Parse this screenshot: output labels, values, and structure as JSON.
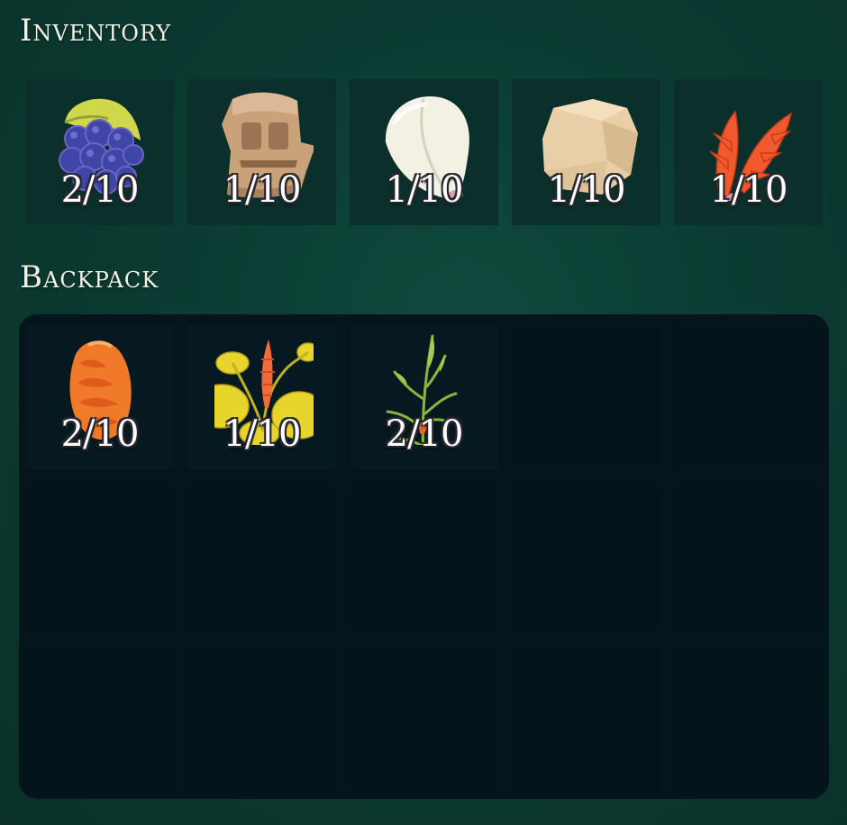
{
  "inventory": {
    "title": "Inventory",
    "slots": [
      {
        "icon": "purple-berry-cluster-icon",
        "count": "2/10"
      },
      {
        "icon": "carved-stone-idol-icon",
        "count": "1/10"
      },
      {
        "icon": "white-seed-pod-icon",
        "count": "1/10"
      },
      {
        "icon": "pale-stone-icon",
        "count": "1/10"
      },
      {
        "icon": "red-flower-spike-icon",
        "count": "1/10"
      }
    ]
  },
  "backpack": {
    "title": "Backpack",
    "slots": [
      {
        "icon": "orange-pinecone-fruit-icon",
        "count": "2/10"
      },
      {
        "icon": "yellow-leaf-plant-icon",
        "count": "1/10"
      },
      {
        "icon": "green-grass-stalk-icon",
        "count": "2/10"
      }
    ]
  },
  "colors": {
    "background": "#0b3b32",
    "inventory_slot": "#0b2f2a",
    "backpack_panel": "#06141b",
    "count_text": "#ffffff",
    "title_text": "#f3f1e6"
  }
}
